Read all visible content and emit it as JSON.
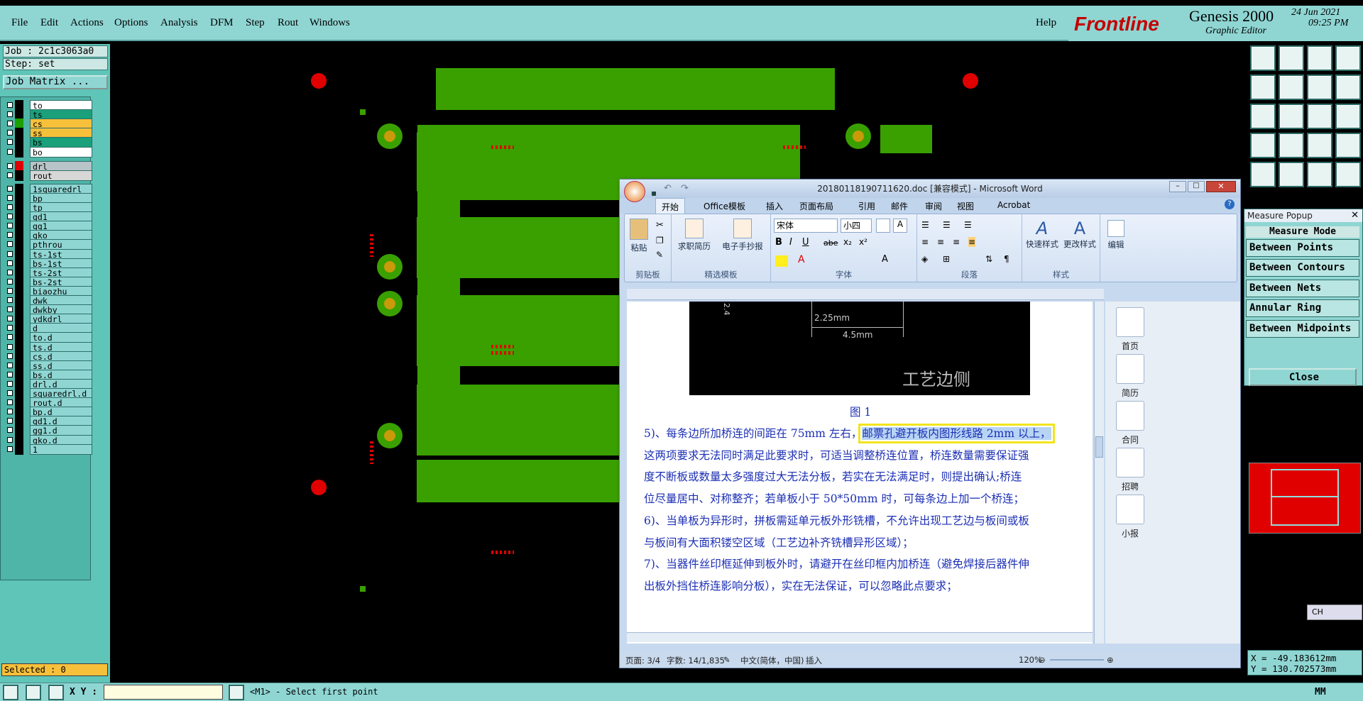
{
  "menu": {
    "items": [
      "File",
      "Edit",
      "Actions",
      "Options",
      "Analysis",
      "DFM",
      "Step",
      "Rout",
      "Windows"
    ],
    "help": "Help"
  },
  "brand": {
    "logo": "Frontline",
    "product": "Genesis 2000",
    "subtitle": "Graphic Editor",
    "date": "24 Jun 2021",
    "time": "09:25 PM"
  },
  "job": {
    "job_label": "Job : 2c1c3063a0",
    "step_label": "Step: set",
    "matrix_button": "Job Matrix ..."
  },
  "layers": [
    {
      "name": "to",
      "color": "#ffffff",
      "swatch": "#000000"
    },
    {
      "name": "ts",
      "color": "#1aa07a",
      "swatch": "#000000"
    },
    {
      "name": "cs",
      "color": "#f7c03b",
      "swatch": "#1aa000"
    },
    {
      "name": "ss",
      "color": "#f7c03b",
      "swatch": "#000000"
    },
    {
      "name": "bs",
      "color": "#1aa07a",
      "swatch": "#000000"
    },
    {
      "name": "bo",
      "color": "#ffffff",
      "swatch": "#000000"
    },
    {
      "name": "drl",
      "color": "#b9c4c8",
      "swatch": "#e10000"
    },
    {
      "name": "rout",
      "color": "#d7d7d7",
      "swatch": "#000000"
    },
    {
      "name": "1squaredrl",
      "color": "#8fd6d3",
      "swatch": "#000000"
    },
    {
      "name": "bp",
      "color": "#8fd6d3",
      "swatch": "#000000"
    },
    {
      "name": "tp",
      "color": "#8fd6d3",
      "swatch": "#000000"
    },
    {
      "name": "gd1",
      "color": "#8fd6d3",
      "swatch": "#000000"
    },
    {
      "name": "gg1",
      "color": "#8fd6d3",
      "swatch": "#000000"
    },
    {
      "name": "gko",
      "color": "#8fd6d3",
      "swatch": "#000000"
    },
    {
      "name": "pthrou",
      "color": "#8fd6d3",
      "swatch": "#000000"
    },
    {
      "name": "ts-1st",
      "color": "#8fd6d3",
      "swatch": "#000000"
    },
    {
      "name": "bs-1st",
      "color": "#8fd6d3",
      "swatch": "#000000"
    },
    {
      "name": "ts-2st",
      "color": "#8fd6d3",
      "swatch": "#000000"
    },
    {
      "name": "bs-2st",
      "color": "#8fd6d3",
      "swatch": "#000000"
    },
    {
      "name": "biaozhu",
      "color": "#8fd6d3",
      "swatch": "#000000"
    },
    {
      "name": "dwk",
      "color": "#8fd6d3",
      "swatch": "#000000"
    },
    {
      "name": "dwkby",
      "color": "#8fd6d3",
      "swatch": "#000000"
    },
    {
      "name": "ydkdrl",
      "color": "#8fd6d3",
      "swatch": "#000000"
    },
    {
      "name": "d",
      "color": "#8fd6d3",
      "swatch": "#000000"
    },
    {
      "name": "to.d",
      "color": "#8fd6d3",
      "swatch": "#000000"
    },
    {
      "name": "ts.d",
      "color": "#8fd6d3",
      "swatch": "#000000"
    },
    {
      "name": "cs.d",
      "color": "#8fd6d3",
      "swatch": "#000000"
    },
    {
      "name": "ss.d",
      "color": "#8fd6d3",
      "swatch": "#000000"
    },
    {
      "name": "bs.d",
      "color": "#8fd6d3",
      "swatch": "#000000"
    },
    {
      "name": "drl.d",
      "color": "#8fd6d3",
      "swatch": "#000000"
    },
    {
      "name": "squaredrl.d",
      "color": "#8fd6d3",
      "swatch": "#000000"
    },
    {
      "name": "rout.d",
      "color": "#8fd6d3",
      "swatch": "#000000"
    },
    {
      "name": "bp.d",
      "color": "#8fd6d3",
      "swatch": "#000000"
    },
    {
      "name": "gd1.d",
      "color": "#8fd6d3",
      "swatch": "#000000"
    },
    {
      "name": "gg1.d",
      "color": "#8fd6d3",
      "swatch": "#000000"
    },
    {
      "name": "gko.d",
      "color": "#8fd6d3",
      "swatch": "#000000"
    },
    {
      "name": "1",
      "color": "#8fd6d3",
      "swatch": "#000000"
    }
  ],
  "selected": "Selected : 0",
  "status": {
    "xy_label": "X Y :",
    "prompt": "<M1> - Select first point",
    "units": "MM"
  },
  "measure": {
    "title": "Measure Popup",
    "mode_label": "Measure Mode",
    "options": [
      "Between Points",
      "Between Contours",
      "Between Nets",
      "Annular Ring",
      "Between Midpoints"
    ],
    "close": "Close"
  },
  "coords": {
    "x": "X = -49.183612mm",
    "y": "Y = 130.702573mm"
  },
  "ime": "CH",
  "word": {
    "title": "20180118190711620.doc [兼容模式] - Microsoft Word",
    "tabs": [
      "开始",
      "Office模板",
      "插入",
      "页面布局",
      "引用",
      "邮件",
      "审阅",
      "视图",
      "Acrobat"
    ],
    "groups": {
      "clipboard": "剪贴板",
      "templates": "精选模板",
      "font": "字体",
      "paragraph": "段落",
      "styles": "样式"
    },
    "buttons": {
      "paste": "粘贴",
      "resume": "求职简历",
      "receipt": "电子手抄报",
      "quick_style": "快速样式",
      "change_style": "更改样式",
      "edit": "编辑"
    },
    "font_name": "宋体",
    "font_size": "小四",
    "figure": {
      "dim1": "2.25mm",
      "dim2": "4.5mm",
      "dim3": "2.4",
      "label": "工艺边侧",
      "caption": "图 1"
    },
    "paragraphs": [
      "5)、每条边所加桥连的间距在 75mm 左右，",
      "邮票孔避开板内图形线路 2mm 以上，",
      "这两项要求无法同时满足此要求时，可适当调整桥连位置，桥连数量需要保证强",
      "度不断板或数量太多强度过大无法分板，若实在无法满足时，则提出确认;桥连",
      "位尽量居中、对称整齐；若单板小于 50*50mm 时，可每条边上加一个桥连；",
      "6)、当单板为异形时，拼板需延单元板外形铣槽，不允许出现工艺边与板间或板",
      "与板间有大面积镂空区域（工艺边补齐铣槽异形区域）；",
      "7)、当器件丝印框延伸到板外时，请避开在丝印框内加桥连（避免焊接后器件伸",
      "出板外挡住桥连影响分板），实在无法保证，可以忽略此点要求；"
    ],
    "side": [
      "首页",
      "简历",
      "合同",
      "招聘",
      "小报"
    ],
    "status": {
      "page": "页面: 3/4",
      "words": "字数: 14/1,835",
      "lang": "中文(简体，中国)",
      "mode": "插入",
      "zoom": "120%"
    }
  }
}
